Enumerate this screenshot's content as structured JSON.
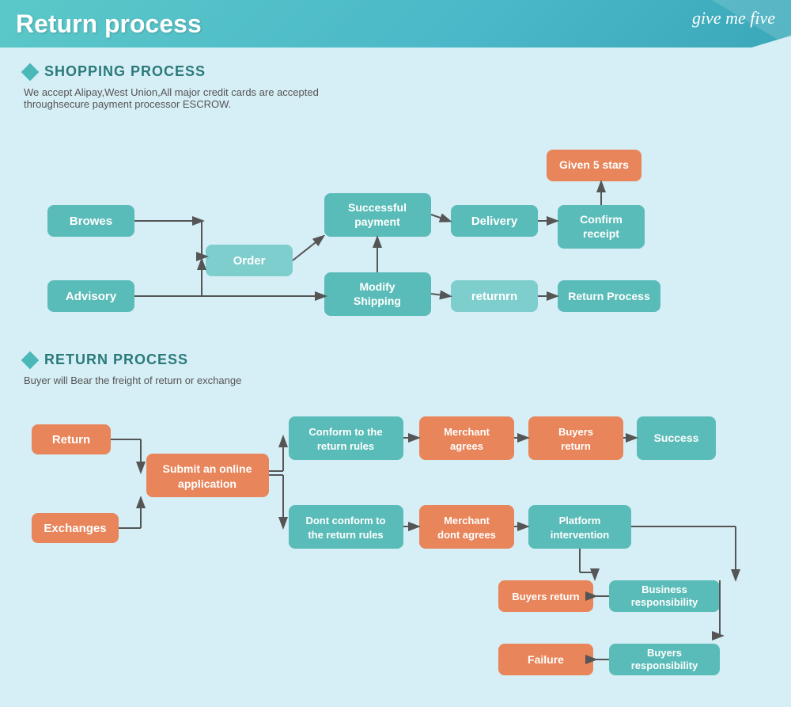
{
  "header": {
    "title": "Return process",
    "logo": "give me five"
  },
  "shopping_section": {
    "heading": "SHOPPING PROCESS",
    "description_line1": "We accept Alipay,West Union,All major credit cards are accepted",
    "description_line2": "throughsecure payment processor ESCROW.",
    "boxes": {
      "browes": "Browes",
      "order": "Order",
      "advisory": "Advisory",
      "successful_payment": "Successful payment",
      "modify_shipping": "Modify Shipping",
      "delivery": "Delivery",
      "confirm_receipt": "Confirm receipt",
      "given_5_stars": "Given 5 stars",
      "returnrn": "returnrn",
      "return_process": "Return Process"
    }
  },
  "return_section": {
    "heading": "RETURN PROCESS",
    "description": "Buyer will Bear the freight of return or exchange",
    "boxes": {
      "return_btn": "Return",
      "exchanges": "Exchanges",
      "submit_application": "Submit an online application",
      "conform_rules": "Conform to the return rules",
      "dont_conform_rules": "Dont conform to the return rules",
      "merchant_agrees": "Merchant agrees",
      "merchant_dont": "Merchant dont agrees",
      "buyers_return_top": "Buyers return",
      "platform": "Platform intervention",
      "success": "Success",
      "buyers_return_bottom": "Buyers return",
      "business_responsibility": "Business responsibility",
      "failure": "Failure",
      "buyers_responsibility": "Buyers responsibility"
    }
  }
}
